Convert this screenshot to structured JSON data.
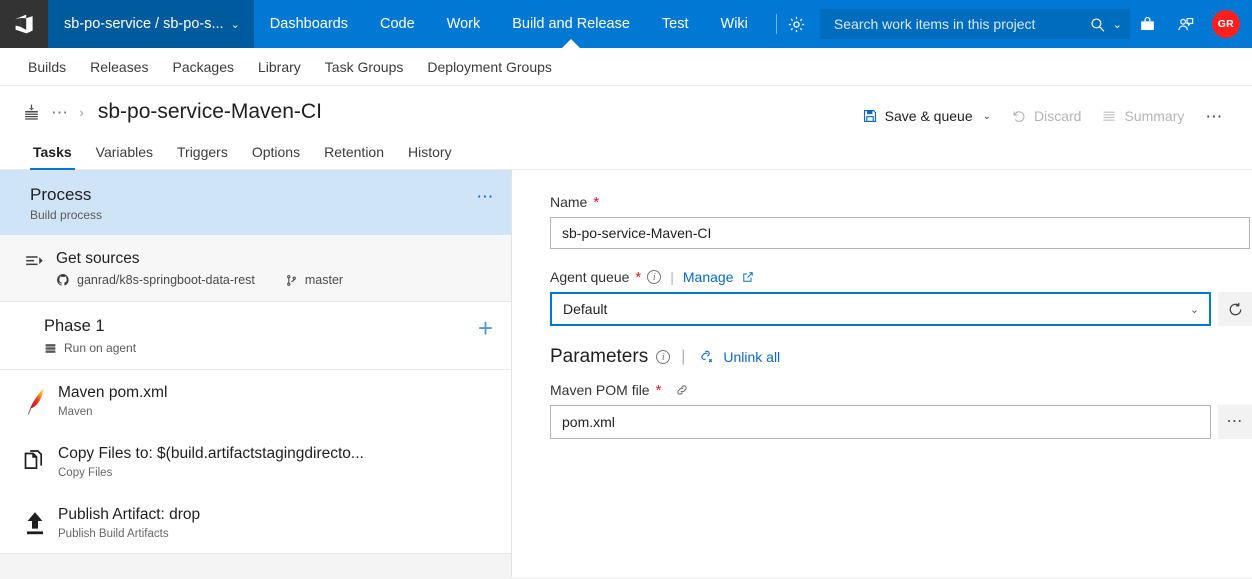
{
  "topnav": {
    "logo_icon": "azure-devops-logo-icon",
    "project_selector": {
      "label": "sb-po-service / sb-po-s...",
      "chevron": "⌄"
    },
    "items": [
      {
        "label": "Dashboards",
        "active": false
      },
      {
        "label": "Code",
        "active": false
      },
      {
        "label": "Work",
        "active": false
      },
      {
        "label": "Build and Release",
        "active": true
      },
      {
        "label": "Test",
        "active": false
      },
      {
        "label": "Wiki",
        "active": false
      }
    ],
    "gear_icon": "gear-icon",
    "search": {
      "placeholder": "Search work items in this project",
      "icon": "search-icon",
      "chevron": "⌄"
    },
    "right_icons": [
      "marketplace-bag-icon",
      "user-feedback-icon"
    ],
    "avatar_initials": "GR",
    "overflow": "⋯",
    "colors": {
      "nav_bg": "#0078d4",
      "project_bg": "#005a9e",
      "search_bg": "#006cbe",
      "logo_bg": "#333333",
      "avatar_bg": "#ff1f1f"
    }
  },
  "subnav": {
    "items": [
      "Builds",
      "Releases",
      "Packages",
      "Library",
      "Task Groups",
      "Deployment Groups"
    ]
  },
  "header": {
    "breadcrumb_icon": "build-definition-icon",
    "breadcrumb_dots": "⋯",
    "breadcrumb_sep": "›",
    "title": "sb-po-service-Maven-CI",
    "toolbar": {
      "save_queue_label": "Save & queue",
      "save_queue_chevron": "⌄",
      "save_icon": "save-disk-icon",
      "discard_label": "Discard",
      "discard_icon": "undo-arrow-icon",
      "summary_label": "Summary",
      "summary_icon": "summary-list-icon",
      "overflow": "⋯"
    }
  },
  "tabs": [
    {
      "label": "Tasks",
      "active": true
    },
    {
      "label": "Variables",
      "active": false
    },
    {
      "label": "Triggers",
      "active": false
    },
    {
      "label": "Options",
      "active": false
    },
    {
      "label": "Retention",
      "active": false
    },
    {
      "label": "History",
      "active": false
    }
  ],
  "sidebar": {
    "process": {
      "title": "Process",
      "subtitle": "Build process",
      "overflow": "⋯",
      "selected_bg": "#cfe4f7"
    },
    "get_sources": {
      "title": "Get sources",
      "icon": "get-sources-icon",
      "repo_icon": "github-icon",
      "repo": "ganrad/k8s-springboot-data-rest",
      "branch_icon": "branch-icon",
      "branch": "master"
    },
    "phase": {
      "title": "Phase 1",
      "subtitle": "Run on agent",
      "agent_icon": "agent-server-icon",
      "add_icon": "+"
    },
    "tasks": [
      {
        "title": "Maven pom.xml",
        "subtitle": "Maven",
        "icon": "maven-feather-icon"
      },
      {
        "title": "Copy Files to: $(build.artifactstagingdirecto...",
        "subtitle": "Copy Files",
        "icon": "copy-files-icon"
      },
      {
        "title": "Publish Artifact: drop",
        "subtitle": "Publish Build Artifacts",
        "icon": "publish-upload-icon"
      }
    ]
  },
  "form": {
    "name": {
      "label": "Name",
      "required": "*",
      "value": "sb-po-service-Maven-CI"
    },
    "agent_queue": {
      "label": "Agent queue",
      "required": "*",
      "info_icon": "info-icon",
      "separator": "|",
      "manage_label": "Manage",
      "manage_external_icon": "external-link-icon",
      "value": "Default",
      "chevron": "⌄",
      "refresh_icon": "refresh-icon"
    },
    "parameters": {
      "title": "Parameters",
      "info_icon": "info-icon",
      "separator": "|",
      "unlink_icon": "unlink-icon",
      "unlink_label": "Unlink all",
      "pom": {
        "label": "Maven POM file",
        "required": "*",
        "link_icon": "link-chain-icon",
        "value": "pom.xml",
        "browse_label": "⋯"
      }
    }
  }
}
